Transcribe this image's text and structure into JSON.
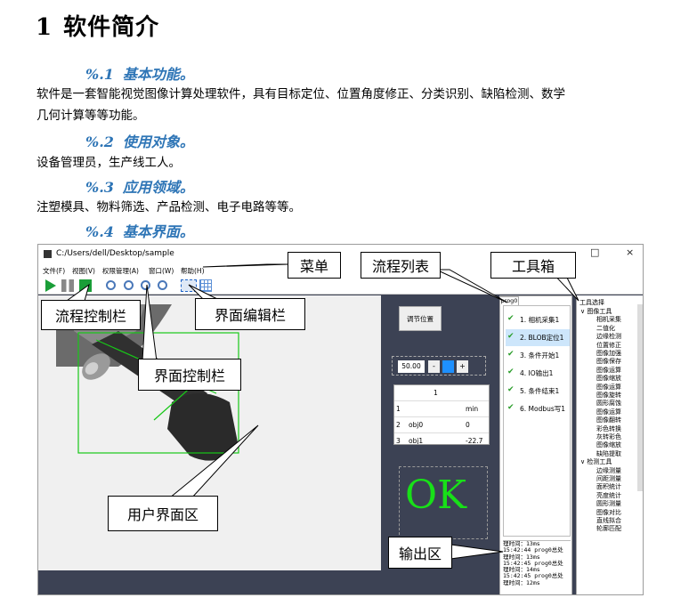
{
  "heading": {
    "number": "1",
    "title": "软件简介"
  },
  "sections": [
    {
      "num": "%.1",
      "title": "基本功能。",
      "body": "软件是一套智能视觉图像计算处理软件，具有目标定位、位置角度修正、分类识别、缺陷检测、数学几何计算等等功能。"
    },
    {
      "num": "%.2",
      "title": "使用对象。",
      "body": "设备管理员，生产线工人。"
    },
    {
      "num": "%.3",
      "title": "应用领域。",
      "body": "注塑模具、物料筛选、产品检测、电子电路等等。"
    },
    {
      "num": "%.4",
      "title": "基本界面。",
      "body": ""
    }
  ],
  "body1_line1": "软件是一套智能视觉图像计算处理软件，具有目标定位、位置角度修正、分类识别、缺陷检测、数学",
  "body1_line2": "几何计算等等功能。",
  "app": {
    "path": "C:/Users/dell/Desktop/sample",
    "window_controls": [
      "—",
      "□",
      "×"
    ],
    "menu": [
      "文件(F)",
      "视图(V)",
      "权限管理(A)",
      "窗口(W)",
      "帮助(H)"
    ],
    "adjust_button": "调节位置",
    "stepper_value": "50.00",
    "stepper_minus": "-",
    "stepper_plus": "+",
    "table": {
      "header": [
        "",
        "1",
        ""
      ],
      "rows": [
        [
          "1",
          "",
          "min"
        ],
        [
          "2",
          "obj0",
          "0"
        ],
        [
          "3",
          "obj1",
          "-22.7"
        ]
      ]
    },
    "result": "OK",
    "flow_tab": "prog0",
    "flow_items": [
      "1. 相机采集1",
      "2. BLOB定位1",
      "3. 条件开始1",
      "4.     IO输出1",
      "5. 条件结束1",
      "6. Modbus写1"
    ],
    "log": [
      "理时间：13ms",
      "15:42:44 prog0总处",
      "理时间：13ms",
      "15:42:45 prog0总处",
      "理时间：14ms",
      "15:42:45 prog0总处",
      "理时间：12ms"
    ],
    "tool_header": "工具选择",
    "tool_groups": [
      {
        "name": "图像工具",
        "items": [
          "相机采集",
          "二值化",
          "边缘检测",
          "位置修正",
          "图像加强",
          "图像保存",
          "图像运算",
          "图像缩放",
          "图像运算",
          "图像旋转",
          "圆形腐蚀",
          "图像运算",
          "图像翻转",
          "彩色转换",
          "灰转彩色",
          "图像缩放",
          "缺陷提取"
        ]
      },
      {
        "name": "检测工具",
        "items": [
          "边缘测量",
          "间距测量",
          "面积统计",
          "亮度统计",
          "圆形测量",
          "图像对比",
          "直线拟合",
          "轮廓匹配"
        ]
      }
    ]
  },
  "callouts": {
    "menu": "菜单",
    "flow_list": "流程列表",
    "toolbox": "工具箱",
    "flow_control": "流程控制栏",
    "ui_edit": "界面编辑栏",
    "ui_control": "界面控制栏",
    "user_area": "用户界面区",
    "output": "输出区"
  }
}
